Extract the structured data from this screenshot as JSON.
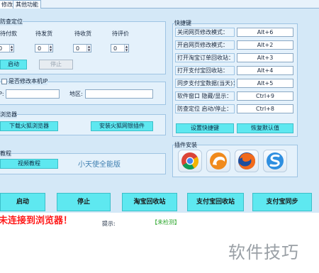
{
  "tabs": [
    {
      "label": "修改"
    },
    {
      "label": "其他功能"
    }
  ],
  "position_panel": {
    "title": "防查定位",
    "columns": [
      "待付款",
      "待发货",
      "待收货",
      "待评价"
    ],
    "values": [
      "0",
      "0",
      "0",
      "0"
    ],
    "start_button": "启动",
    "stop_button": "停止"
  },
  "ip_panel": {
    "checkbox_label": "是否修改本机IP",
    "ip_label": "P:",
    "region_label": "地区:"
  },
  "browser_panel": {
    "title": "浏览器",
    "download_button": "下载火狐浏览器",
    "plugin_button": "安装火狐网银插件"
  },
  "tutorial_panel": {
    "title": "教程",
    "video_button": "视频教程",
    "version_text": "小天使全能版"
  },
  "hotkeys_panel": {
    "title": "快捷键",
    "items": [
      {
        "label": "关闭网页修改模式：",
        "key": "Alt+6"
      },
      {
        "label": "开启网页修改模式：",
        "key": "Alt+2"
      },
      {
        "label": "打开淘宝订单回收站：",
        "key": "Alt+3"
      },
      {
        "label": "打开支付宝回收站：",
        "key": "Alt+4"
      },
      {
        "label": "同步支付宝数据(当天)：",
        "key": "Alt+5"
      },
      {
        "label": "软件窗口 隐藏/显示：",
        "key": "Ctrl+9"
      },
      {
        "label": "防查定位 启动/停止：",
        "key": "Ctrl+8"
      }
    ],
    "set_button": "设置快捷键",
    "reset_button": "恢复默认值"
  },
  "plugins_panel": {
    "title": "插件安装",
    "icons": [
      "chrome-icon",
      "uc-browser-icon",
      "firefox-icon",
      "sogou-browser-icon"
    ]
  },
  "action_buttons": [
    {
      "label": "启动"
    },
    {
      "label": "停止"
    },
    {
      "label": "淘宝回收站"
    },
    {
      "label": "支付宝回收站"
    },
    {
      "label": "支付宝同步"
    }
  ],
  "status": {
    "connection_text": "未连接到浏览器！",
    "tip_label": "提示:",
    "detect_text": "【未检测】"
  },
  "watermark": {
    "text": "软件技巧"
  },
  "colors": {
    "window_bg": "#d4e8f7",
    "button_accent": "#5ee8f0",
    "error_red": "#ff1a1a",
    "detect_green": "#2aa52a"
  }
}
